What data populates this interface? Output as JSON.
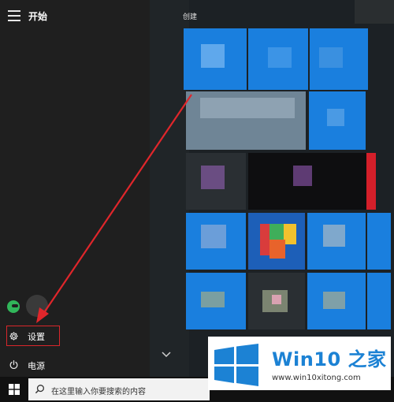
{
  "start_menu": {
    "title": "开始",
    "group_label": "创建",
    "settings_label": "设置",
    "power_label": "电源"
  },
  "taskbar": {
    "search_placeholder": "在这里输入你要搜索的内容"
  },
  "watermark": {
    "title": "Win10 之家",
    "url": "www.win10xitong.com"
  },
  "colors": {
    "tile_blue": "#1a7fde",
    "annotation_red": "#e0262b",
    "watermark_blue": "#1c82d4"
  },
  "icons": {
    "menu": "hamburger-icon",
    "settings": "gear-icon",
    "power": "power-icon",
    "windows": "windows-logo-icon",
    "search": "search-icon"
  }
}
